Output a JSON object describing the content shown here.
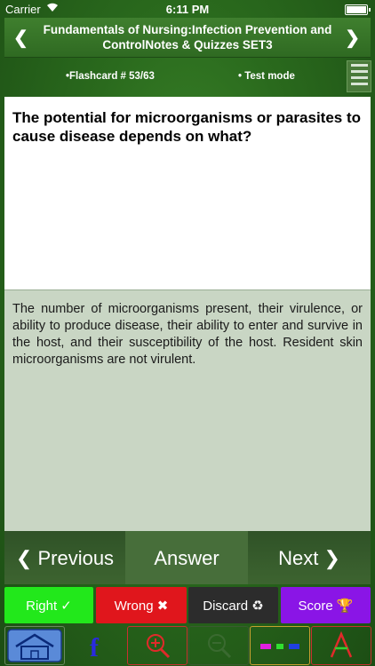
{
  "status": {
    "carrier": "Carrier",
    "time": "6:11 PM",
    "wifi_icon": "wifi-icon",
    "battery_icon": "battery-icon"
  },
  "header": {
    "title": "Fundamentals of Nursing:Infection Prevention and ControlNotes & Quizzes SET3",
    "prev_glyph": "❮",
    "next_glyph": "❯"
  },
  "info": {
    "flashcard": "•Flashcard #  53/63",
    "mode": "• Test mode"
  },
  "card": {
    "question": "The potential for microorganisms or parasites to cause disease depends on what?",
    "answer": "The number of microorganisms present, their virulence, or ability to produce disease, their ability to enter and survive in the host, and their susceptibility of the host. Resident skin microorganisms are not virulent."
  },
  "nav": {
    "previous": "❮  Previous",
    "answer": "Answer",
    "next": "Next  ❯"
  },
  "actions": {
    "right": "Right  ✓",
    "wrong": "Wrong  ✖",
    "discard": "Discard  ♻",
    "score": "Score  🏆"
  },
  "colors": {
    "right": "#22e81b",
    "wrong": "#e0161c",
    "discard": "#2c2c2c",
    "score": "#8a15e6",
    "background": "#2a6a1d"
  },
  "toolbar_icons": [
    "home-icon",
    "facebook-icon",
    "zoom-in-icon",
    "zoom-out-icon",
    "color-palette-icon",
    "font-icon"
  ]
}
